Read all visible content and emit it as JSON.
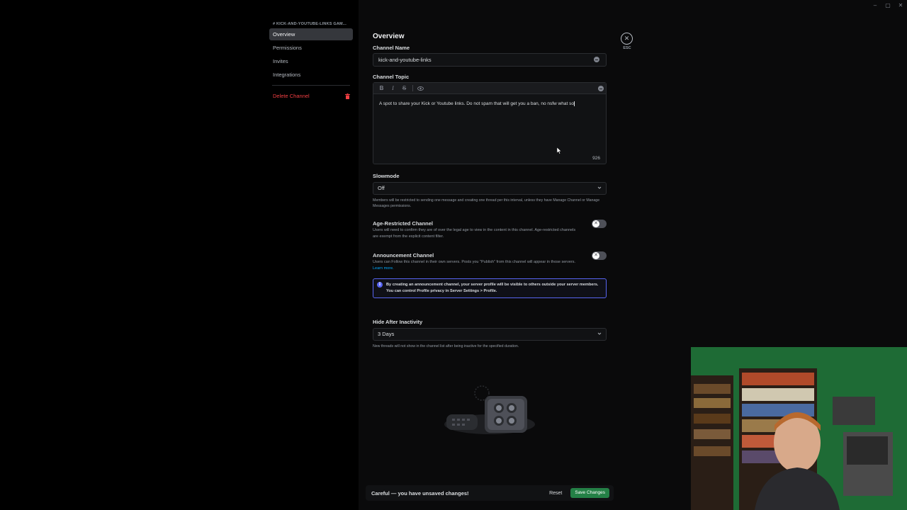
{
  "sidebar": {
    "header": "# KICK-AND-YOUTUBE-LINKS GAM...",
    "items": [
      {
        "label": "Overview"
      },
      {
        "label": "Permissions"
      },
      {
        "label": "Invites"
      },
      {
        "label": "Integrations"
      }
    ],
    "delete_label": "Delete Channel"
  },
  "main": {
    "title": "Overview",
    "channel_name": {
      "label": "Channel Name",
      "value": "kick-and-youtube-links"
    },
    "channel_topic": {
      "label": "Channel Topic",
      "toolbar": {
        "bold": "B",
        "italic": "I",
        "strike": "S"
      },
      "value": "A spot to share your Kick or Youtube links. Do not spam that will get you a ban, no nsfw what so",
      "char_count": "926"
    },
    "slowmode": {
      "label": "Slowmode",
      "value": "Off",
      "help": "Members will be restricted to sending one message and creating one thread per this interval, unless they have Manage Channel or Manage Messages permissions."
    },
    "age_restricted": {
      "title": "Age-Restricted Channel",
      "desc": "Users will need to confirm they are of over the legal age to view in the content in this channel. Age-restricted channels are exempt from the explicit content filter.",
      "enabled": false
    },
    "announcement": {
      "title": "Announcement Channel",
      "desc": "Users can Follow this channel in their own servers. Posts you \"Publish\" from this channel will appear in those servers.",
      "learn_more": "Learn more.",
      "enabled": false
    },
    "info_notice": "By creating an announcement channel, your server profile will be visible to others outside your server members. You can control Profile privacy in Server Settings > Profile.",
    "hide_after_inactivity": {
      "label": "Hide After Inactivity",
      "value": "3 Days",
      "help": "New threads will not show in the channel list after being inactive for the specified duration."
    },
    "close": {
      "label": "ESC"
    }
  },
  "save_bar": {
    "message": "Careful — you have unsaved changes!",
    "reset_label": "Reset",
    "save_label": "Save Changes"
  },
  "colors": {
    "accent": "#5865f2",
    "danger": "#f23f43",
    "success": "#248046",
    "link": "#00a8fc"
  }
}
